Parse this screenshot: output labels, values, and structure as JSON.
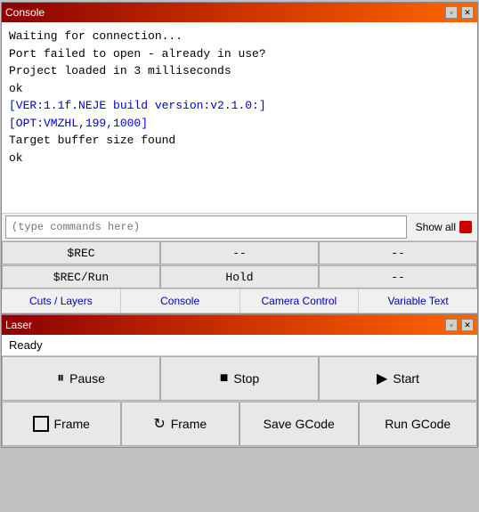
{
  "console_window": {
    "title": "Console",
    "controls": {
      "restore": "▫",
      "close": "✕"
    },
    "output_lines": [
      {
        "text": "Waiting for connection...",
        "style": "normal"
      },
      {
        "text": "Port failed to open - already in use?",
        "style": "normal"
      },
      {
        "text": "Project loaded in 3 milliseconds",
        "style": "normal"
      },
      {
        "text": "ok",
        "style": "normal"
      },
      {
        "text": "[VER:1.1f.NEJE build version:v2.1.0:]",
        "style": "blue"
      },
      {
        "text": "[OPT:VMZHL,199,1000]",
        "style": "blue"
      },
      {
        "text": "Target buffer size found",
        "style": "normal"
      },
      {
        "text": "ok",
        "style": "normal"
      }
    ],
    "input_placeholder": "(type commands here)",
    "show_all_label": "Show all",
    "buttons_row1": {
      "btn1": "$REC",
      "btn2": "--",
      "btn3": "--"
    },
    "buttons_row2": {
      "btn1": "$REC/Run",
      "btn2": "Hold",
      "btn3": "--"
    },
    "tabs": [
      "Cuts / Layers",
      "Console",
      "Camera Control",
      "Variable Text"
    ]
  },
  "laser_window": {
    "title": "Laser",
    "controls": {
      "restore": "▫",
      "close": "✕"
    },
    "status": "Ready",
    "buttons_row1": [
      {
        "icon": "⏸",
        "label": "Pause"
      },
      {
        "icon": "■",
        "label": "Stop"
      },
      {
        "icon": "▶",
        "label": "Start"
      }
    ],
    "buttons_row2": [
      {
        "icon": "⬜",
        "label": "Frame",
        "icon_type": "corner"
      },
      {
        "icon": "↻",
        "label": "Frame",
        "icon_type": "rotate"
      },
      {
        "icon": "",
        "label": "Save GCode"
      },
      {
        "icon": "",
        "label": "Run GCode"
      }
    ]
  }
}
